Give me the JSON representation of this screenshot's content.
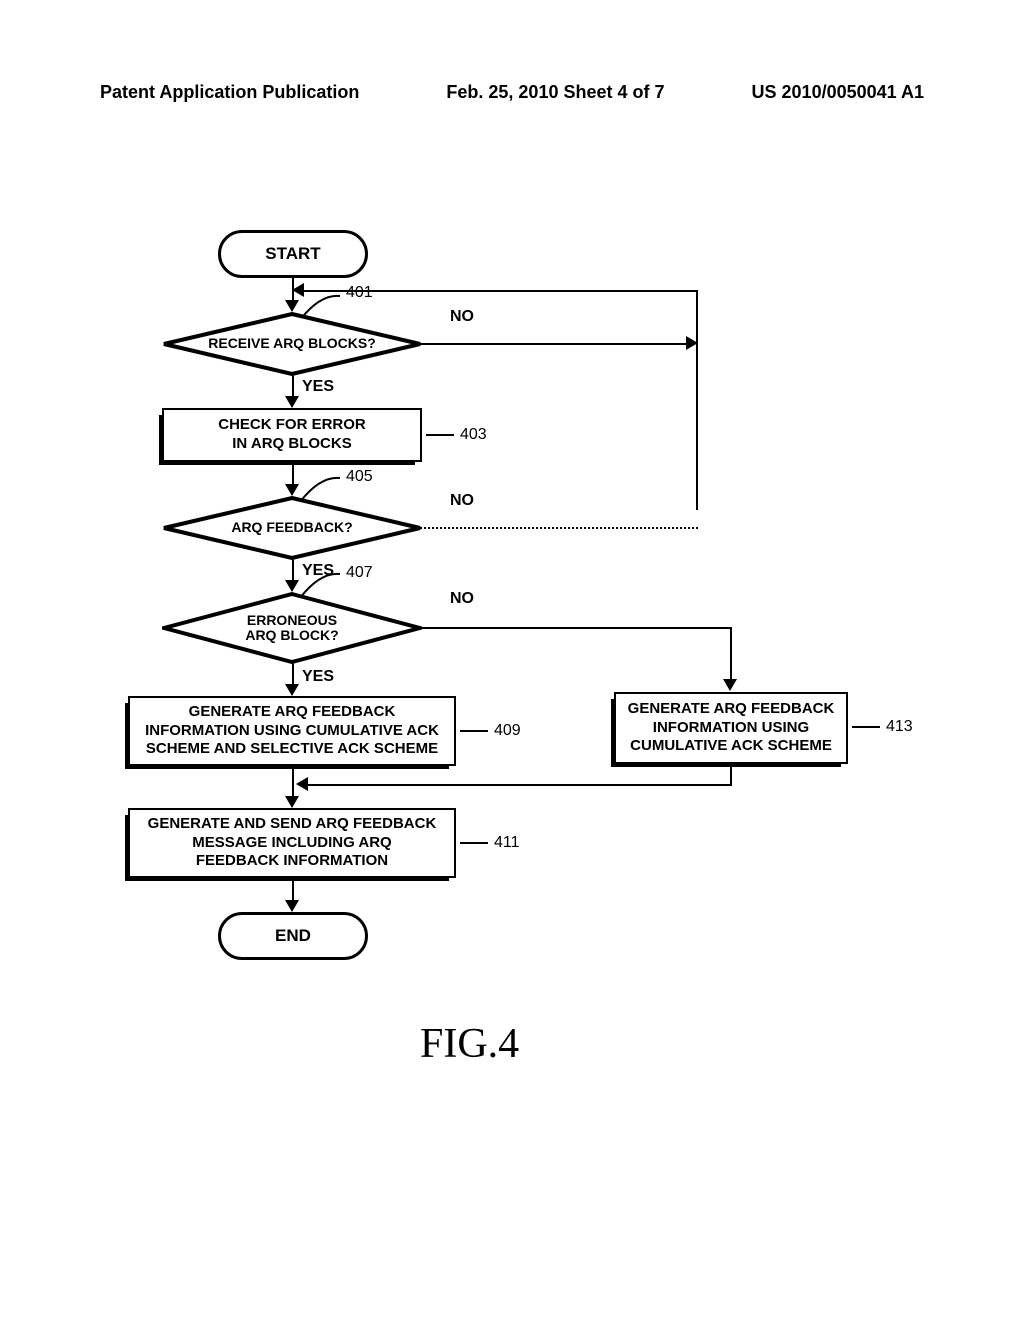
{
  "header": {
    "left": "Patent Application Publication",
    "center": "Feb. 25, 2010   Sheet 4 of 7",
    "right": "US 2010/0050041 A1"
  },
  "flow": {
    "start": "START",
    "end": "END",
    "dec1": "RECEIVE ARQ BLOCKS?",
    "dec2": "ARQ FEEDBACK?",
    "dec3": "ERRONEOUS\nARQ BLOCK?",
    "proc403": "CHECK FOR ERROR\nIN ARQ BLOCKS",
    "proc409": "GENERATE ARQ FEEDBACK\nINFORMATION USING CUMULATIVE ACK\nSCHEME AND SELECTIVE ACK SCHEME",
    "proc411": "GENERATE AND SEND ARQ FEEDBACK\nMESSAGE INCLUDING ARQ\nFEEDBACK INFORMATION",
    "proc413": "GENERATE ARQ FEEDBACK\nINFORMATION USING\nCUMULATIVE ACK SCHEME",
    "yes": "YES",
    "no": "NO",
    "ref401": "401",
    "ref403": "403",
    "ref405": "405",
    "ref407": "407",
    "ref409": "409",
    "ref411": "411",
    "ref413": "413"
  },
  "figure": "FIG.4"
}
